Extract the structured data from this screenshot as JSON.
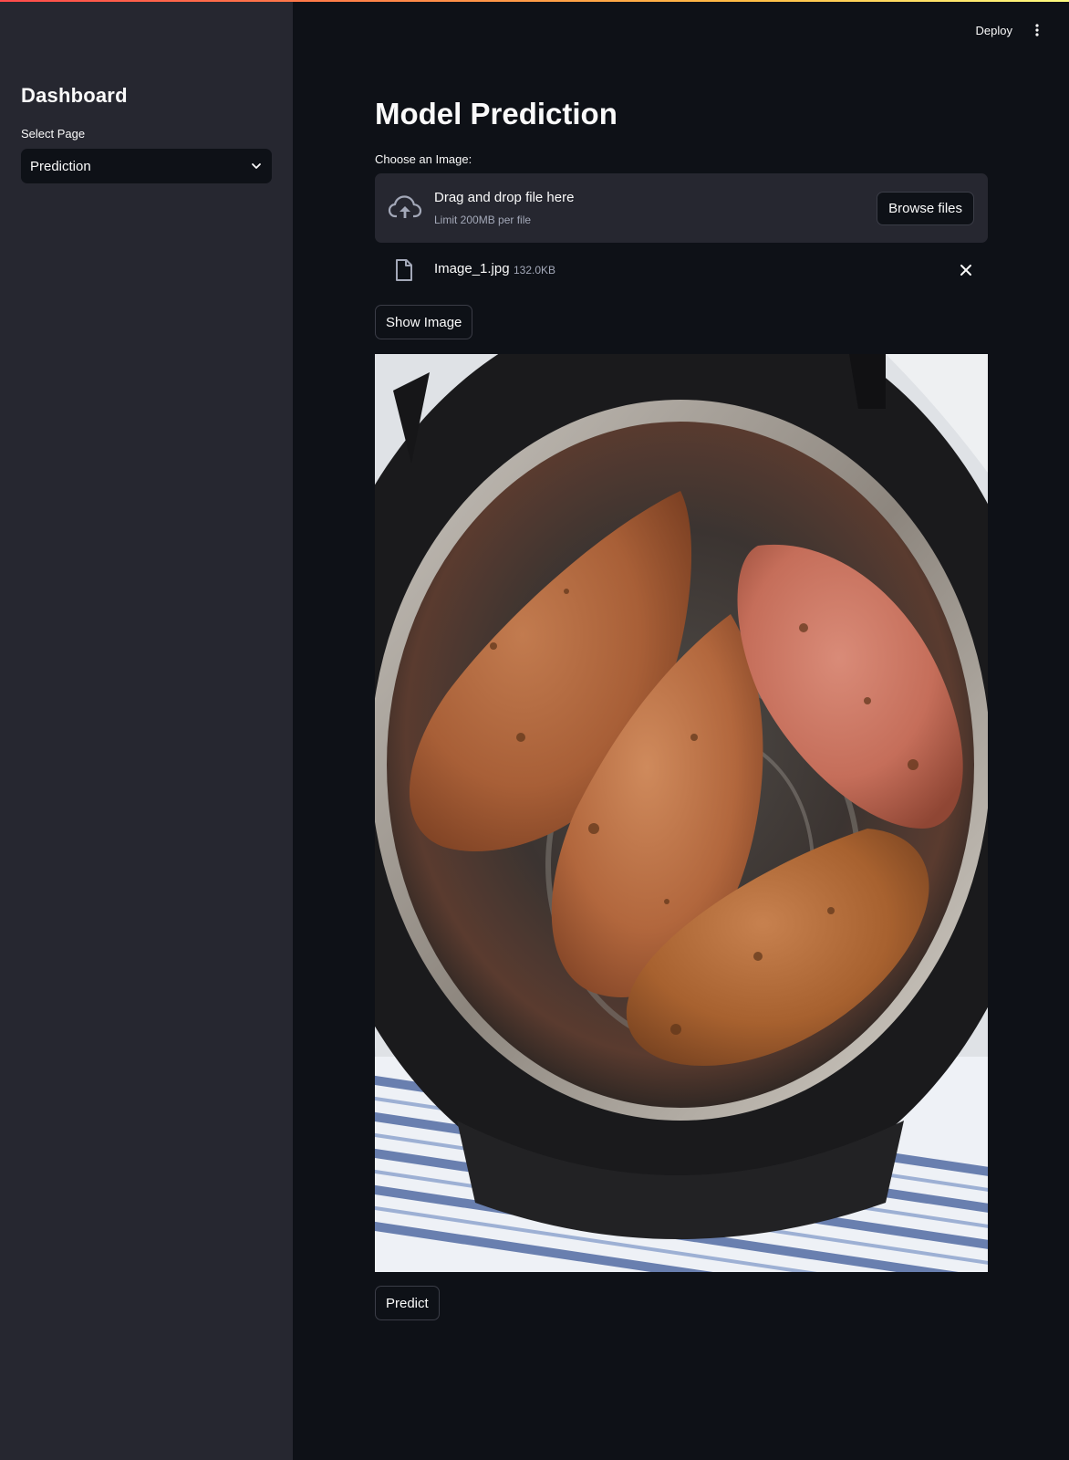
{
  "sidebar": {
    "title": "Dashboard",
    "select_label": "Select Page",
    "select_value": "Prediction"
  },
  "header": {
    "deploy_label": "Deploy",
    "menu_icon": "kebab-menu-icon"
  },
  "main": {
    "title": "Model Prediction",
    "uploader": {
      "label": "Choose an Image:",
      "drop_title": "Drag and drop file here",
      "drop_subtitle": "Limit 200MB per file",
      "browse_label": "Browse files",
      "icon": "cloud-upload-icon"
    },
    "file": {
      "name": "Image_1.jpg",
      "size": "132.0KB",
      "icon": "file-icon",
      "remove_icon": "close-icon"
    },
    "show_image_label": "Show Image",
    "image": {
      "subject": "four sweet potatoes in a pressure cooker pot"
    },
    "predict_label": "Predict"
  },
  "colors": {
    "app_background": "#0e1117",
    "sidebar_background": "#262730",
    "accent_gradient_start": "#ff4b4b",
    "accent_gradient_end": "#fffd80",
    "muted_text": "#a3a8b8"
  }
}
